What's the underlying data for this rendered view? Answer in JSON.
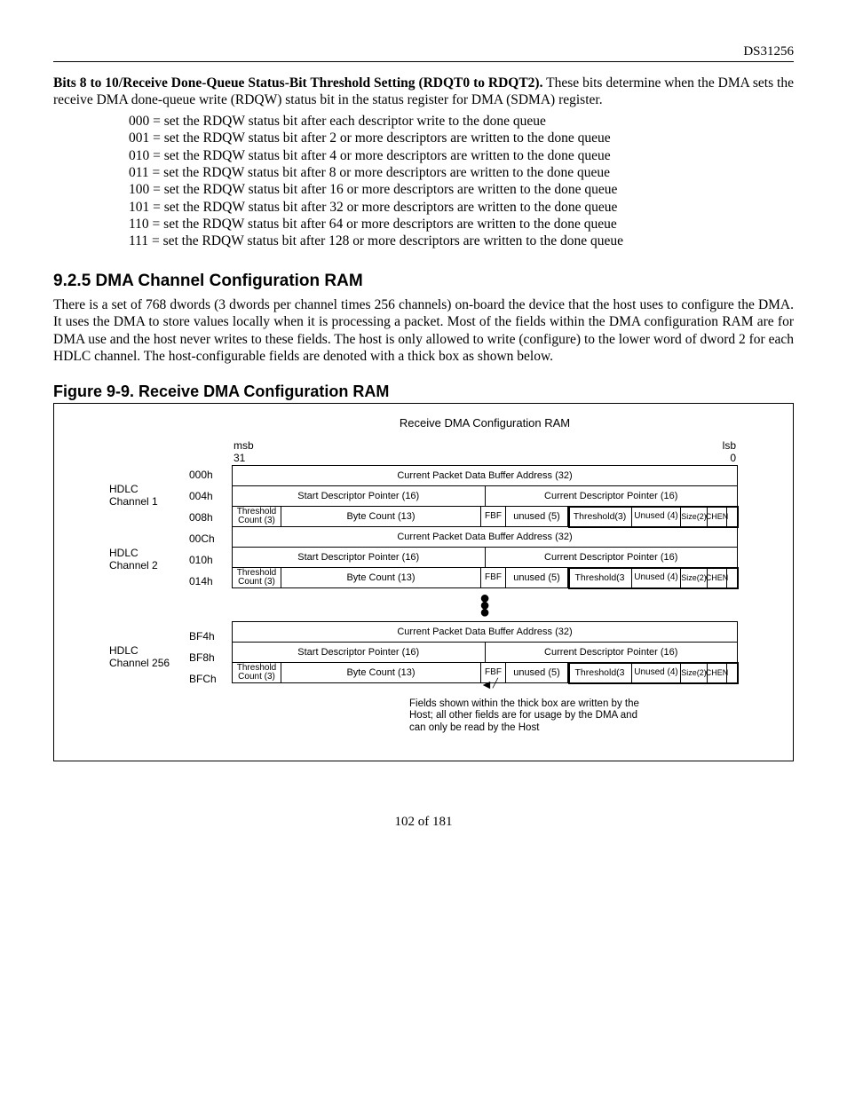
{
  "doc_id": "DS31256",
  "bits_section": {
    "title_bold": "Bits 8 to 10/Receive Done-Queue Status-Bit Threshold Setting (RDQT0 to RDQT2).",
    "title_rest": " These bits determine when the DMA sets the receive DMA done-queue write (RDQW) status bit in the status register for DMA (SDMA) register.",
    "lines": [
      "000 = set the RDQW status bit after each descriptor write to the done queue",
      "001 = set the RDQW status bit after 2 or more descriptors are written to the done queue",
      "010 = set the RDQW status bit after 4 or more descriptors are written to the done queue",
      "011 = set the RDQW status bit after 8 or more descriptors are written to the done queue",
      "100 = set the RDQW status bit after 16 or more descriptors are written to the done queue",
      "101 = set the RDQW status bit after 32 or more descriptors are written to the done queue",
      "110 = set the RDQW status bit after 64 or more descriptors are written to the done queue",
      "111 = set the RDQW status bit after 128 or more descriptors are written to the done queue"
    ]
  },
  "section_heading": "9.2.5 DMA Channel Configuration RAM",
  "section_para": "There is a set of 768 dwords (3 dwords per channel times 256 channels) on-board the device that the host uses to configure the DMA. It uses the DMA to store values locally when it is processing a packet. Most of the fields within the DMA configuration RAM are for DMA use and the host never writes to these fields. The host is only allowed to write (configure) to the lower word of dword 2 for each HDLC channel. The host-configurable fields are denoted with a thick box as shown below.",
  "figure_title": "Figure 9-9. Receive DMA Configuration RAM",
  "ram": {
    "main_title": "Receive DMA Configuration RAM",
    "msb_label_top": "msb",
    "msb_label_bot": "31",
    "lsb_label_top": "lsb",
    "lsb_label_bot": "0",
    "channels": [
      {
        "label_l1": "HDLC",
        "label_l2": "Channel 1",
        "addrs": [
          "000h",
          "004h",
          "008h"
        ]
      },
      {
        "label_l1": "HDLC",
        "label_l2": "Channel 2",
        "addrs": [
          "00Ch",
          "010h",
          "014h"
        ]
      },
      {
        "label_l1": "HDLC",
        "label_l2": "Channel 256",
        "addrs": [
          "BF4h",
          "BF8h",
          "BFCh"
        ]
      }
    ],
    "row_full": "Current Packet Data Buffer Address (32)",
    "row_half_a": "Start Descriptor Pointer (16)",
    "row_half_b": "Current Descriptor Pointer (16)",
    "f_thc": "Threshold Count (3)",
    "f_bc": "Byte Count (13)",
    "f_fbf": "FBF",
    "f_un5": "unused (5)",
    "f_th3_a": "Threshold(3)",
    "f_th3_b": "Threshold(3",
    "f_un4": "Unused (4)",
    "f_sz2_top": "Size",
    "f_sz2_bot": "(2)",
    "f_ch_top": "CH",
    "f_ch_bot": "EN",
    "note_text": "Fields shown within the thick box are written by the Host; all other fields are for usage by the DMA and can only be read by the Host"
  },
  "footer": "102 of 181"
}
